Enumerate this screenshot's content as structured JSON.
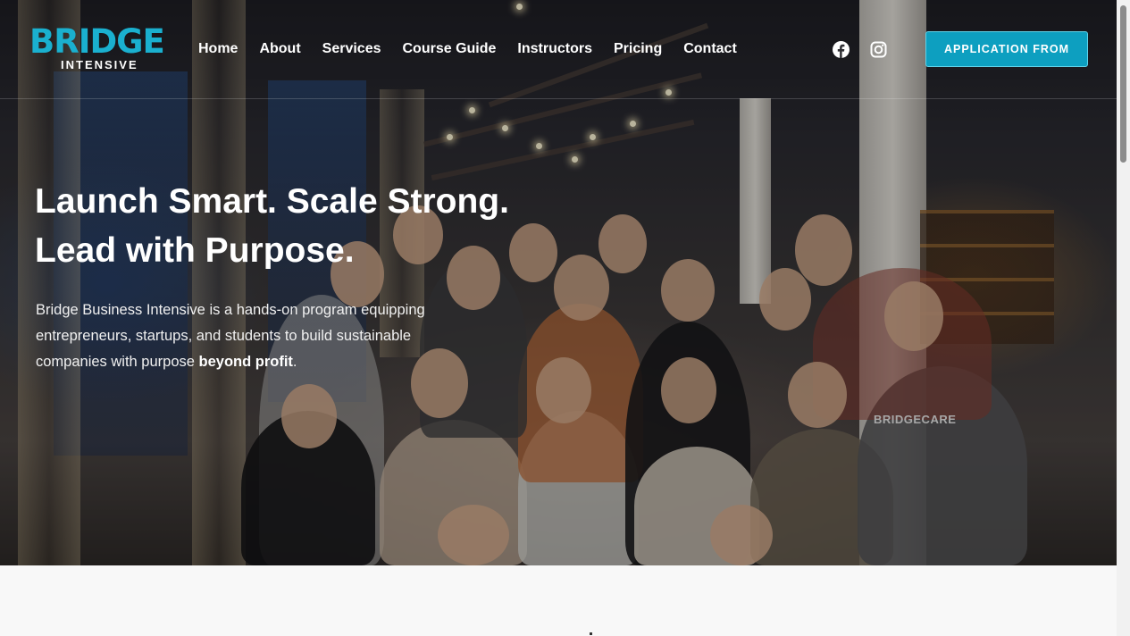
{
  "brand": {
    "logo_main": "BRIDGE",
    "logo_sub": "INTENSIVE",
    "accent_color": "#1ab0cf"
  },
  "nav": {
    "items": [
      "Home",
      "About",
      "Services",
      "Course Guide",
      "Instructors",
      "Pricing",
      "Contact"
    ]
  },
  "social": {
    "facebook_icon": "facebook-icon",
    "instagram_icon": "instagram-icon"
  },
  "cta": {
    "label": "APPLICATION FROM"
  },
  "hero": {
    "title_line1": "Launch Smart. Scale Strong.",
    "title_line2": "Lead with Purpose.",
    "text_main": "Bridge Business Intensive is a hands-on program equipping entrepreneurs, startups, and students to build sustainable companies with purpose ",
    "text_bold": "beyond profit",
    "text_end": ".",
    "shirt_text": "BRIDGECARE"
  }
}
